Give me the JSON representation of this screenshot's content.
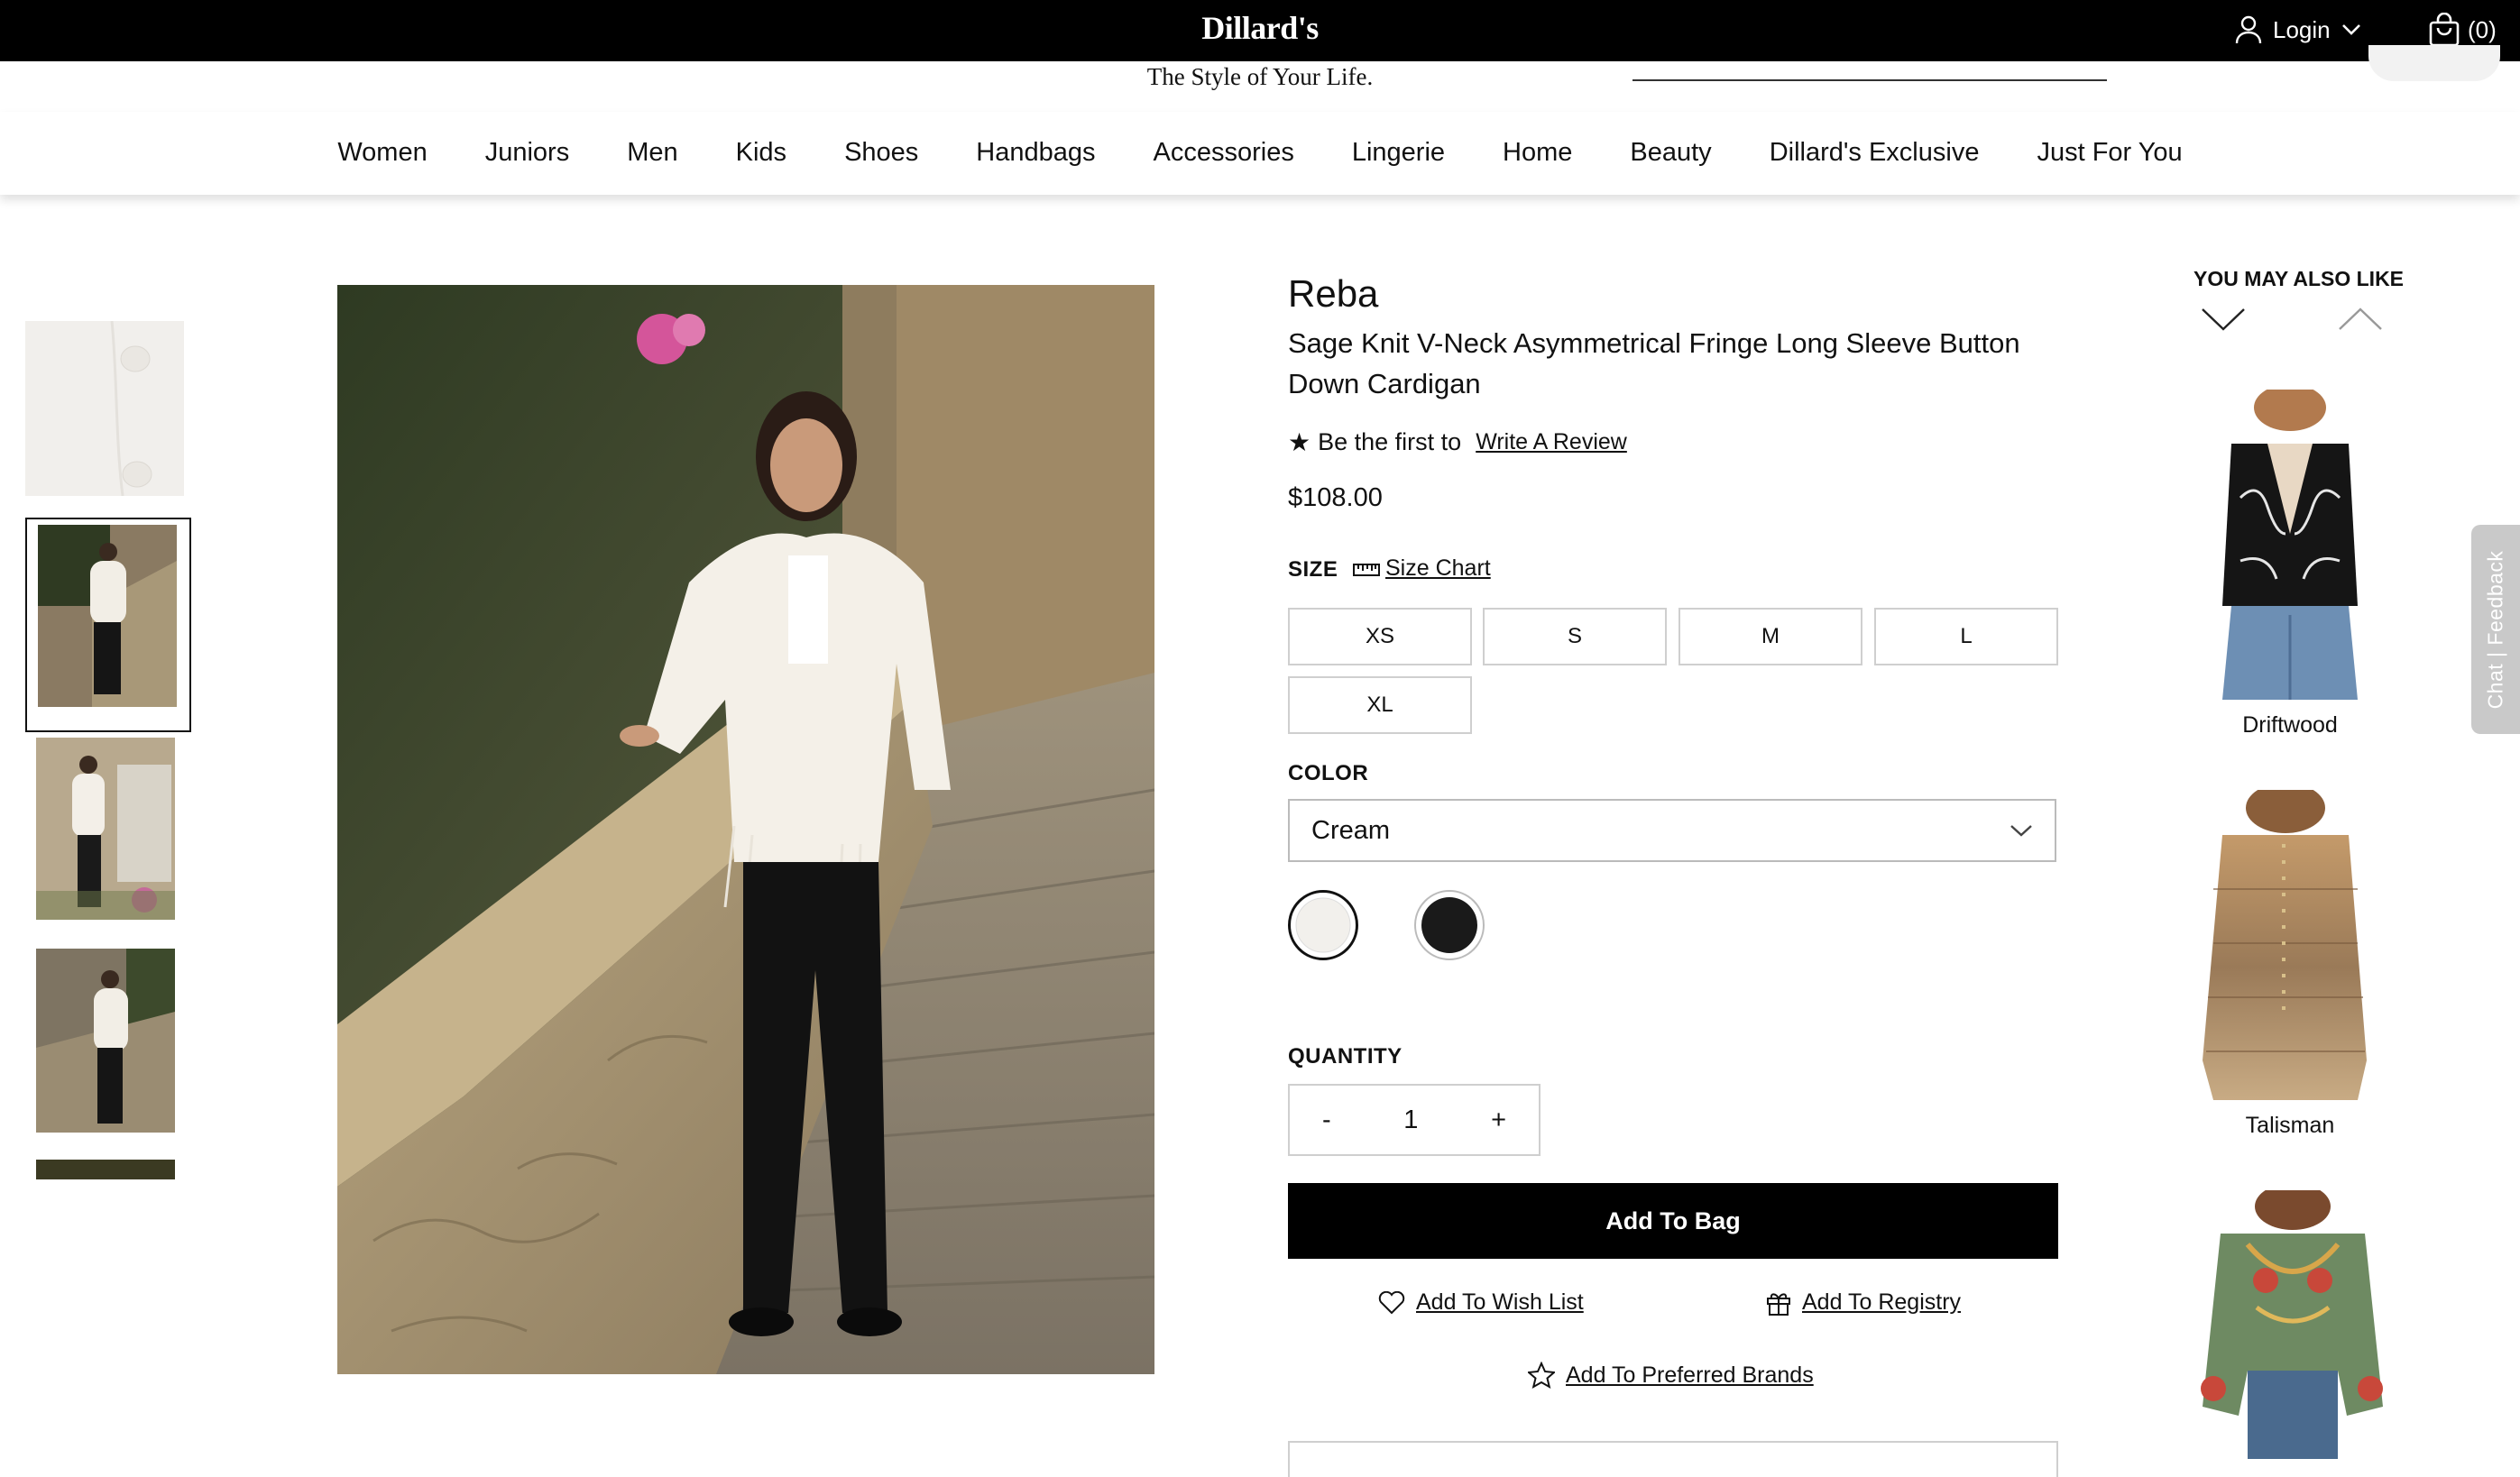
{
  "header": {
    "logo": "Dillard's",
    "tagline": "The Style of Your Life.",
    "login_label": "Login",
    "cart_count": "(0)"
  },
  "nav": {
    "items": [
      "Women",
      "Juniors",
      "Men",
      "Kids",
      "Shoes",
      "Handbags",
      "Accessories",
      "Lingerie",
      "Home",
      "Beauty",
      "Dillard's Exclusive",
      "Just For You"
    ]
  },
  "product": {
    "brand": "Reba",
    "name": "Sage Knit V-Neck Asymmetrical Fringe Long Sleeve Button Down Cardigan",
    "review_prompt": "Be the first to",
    "review_link": "Write A Review",
    "price": "$108.00",
    "size_label": "SIZE",
    "size_chart_label": "Size Chart",
    "sizes": [
      "XS",
      "S",
      "M",
      "L",
      "XL"
    ],
    "color_label": "COLOR",
    "color_selected": "Cream",
    "swatches": [
      {
        "name": "cream",
        "color": "#f2f0ec"
      },
      {
        "name": "black",
        "color": "#1a1a1a"
      }
    ],
    "quantity_label": "QUANTITY",
    "quantity_minus": "-",
    "quantity_value": "1",
    "quantity_plus": "+",
    "add_to_bag": "Add To Bag",
    "wish_list": "Add To Wish List",
    "registry": "Add To Registry",
    "preferred_brands": "Add To Preferred Brands"
  },
  "recommendations": {
    "title": "YOU MAY ALSO LIKE",
    "items": [
      {
        "label": "Driftwood"
      },
      {
        "label": "Talisman"
      },
      {
        "label": ""
      }
    ]
  },
  "feedback_tab": "Chat | Feedback",
  "colors": {
    "topbar": "#000000",
    "button": "#000000",
    "border": "#cfcfcf"
  }
}
